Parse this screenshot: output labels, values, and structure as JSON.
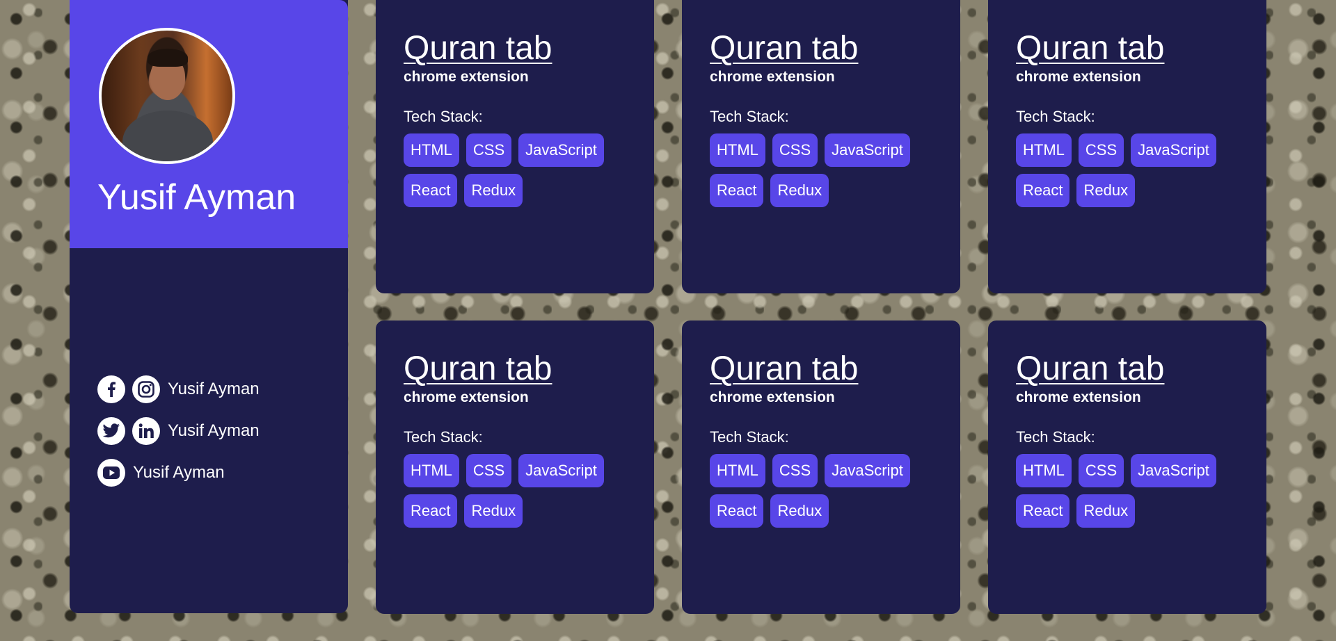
{
  "profile": {
    "name": "Yusif Ayman",
    "socials": [
      {
        "icons": [
          "facebook-icon",
          "instagram-icon"
        ],
        "label": "Yusif Ayman"
      },
      {
        "icons": [
          "twitter-icon",
          "linkedin-icon"
        ],
        "label": "Yusif Ayman"
      },
      {
        "icons": [
          "youtube-icon"
        ],
        "label": "Yusif Ayman"
      }
    ],
    "accent_color": "#5846e8",
    "card_color": "#1e1d4c"
  },
  "projects": [
    {
      "title": "Quran tab",
      "subtitle": "chrome extension",
      "stack_label": "Tech Stack:",
      "tags": [
        "HTML",
        "CSS",
        "JavaScript",
        "React",
        "Redux"
      ]
    },
    {
      "title": "Quran tab",
      "subtitle": "chrome extension",
      "stack_label": "Tech Stack:",
      "tags": [
        "HTML",
        "CSS",
        "JavaScript",
        "React",
        "Redux"
      ]
    },
    {
      "title": "Quran tab",
      "subtitle": "chrome extension",
      "stack_label": "Tech Stack:",
      "tags": [
        "HTML",
        "CSS",
        "JavaScript",
        "React",
        "Redux"
      ]
    },
    {
      "title": "Quran tab",
      "subtitle": "chrome extension",
      "stack_label": "Tech Stack:",
      "tags": [
        "HTML",
        "CSS",
        "JavaScript",
        "React",
        "Redux"
      ]
    },
    {
      "title": "Quran tab",
      "subtitle": "chrome extension",
      "stack_label": "Tech Stack:",
      "tags": [
        "HTML",
        "CSS",
        "JavaScript",
        "React",
        "Redux"
      ]
    },
    {
      "title": "Quran tab",
      "subtitle": "chrome extension",
      "stack_label": "Tech Stack:",
      "tags": [
        "HTML",
        "CSS",
        "JavaScript",
        "React",
        "Redux"
      ]
    }
  ]
}
